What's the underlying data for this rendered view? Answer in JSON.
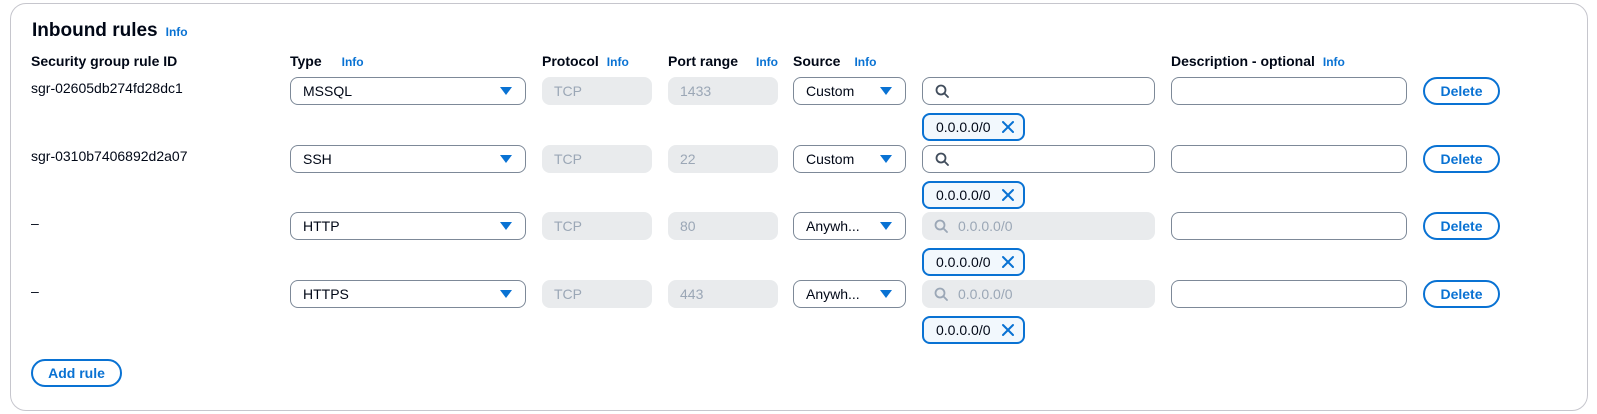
{
  "panel": {
    "title": "Inbound rules",
    "info_label": "Info"
  },
  "columns": {
    "rule_id": "Security group rule ID",
    "type": "Type",
    "protocol": "Protocol",
    "port_range": "Port range",
    "source": "Source",
    "description": "Description - optional",
    "info_label": "Info"
  },
  "rules": [
    {
      "id": "sgr-02605db274fd28dc1",
      "type": "MSSQL",
      "protocol": "TCP",
      "port_range": "1433",
      "source": "Custom",
      "search_value": "",
      "search_placeholder": "",
      "cidr_token": "0.0.0.0/0",
      "description": "",
      "delete_label": "Delete"
    },
    {
      "id": "sgr-0310b7406892d2a07",
      "type": "SSH",
      "protocol": "TCP",
      "port_range": "22",
      "source": "Custom",
      "search_value": "",
      "search_placeholder": "",
      "cidr_token": "0.0.0.0/0",
      "description": "",
      "delete_label": "Delete"
    },
    {
      "id": "–",
      "type": "HTTP",
      "protocol": "TCP",
      "port_range": "80",
      "source": "Anywh...",
      "search_value": "0.0.0.0/0",
      "search_placeholder": "",
      "cidr_token": "0.0.0.0/0",
      "description": "",
      "delete_label": "Delete"
    },
    {
      "id": "–",
      "type": "HTTPS",
      "protocol": "TCP",
      "port_range": "443",
      "source": "Anywh...",
      "search_value": "0.0.0.0/0",
      "search_placeholder": "",
      "cidr_token": "0.0.0.0/0",
      "description": "",
      "delete_label": "Delete"
    }
  ],
  "add_rule_label": "Add rule",
  "icons": {
    "search": "search-icon",
    "dismiss": "close-icon",
    "dropdown": "caret-down-icon"
  },
  "colors": {
    "accent": "#0972d3",
    "text": "#000716",
    "disabled_bg": "#e9ebed",
    "disabled_text": "#9ba7b6",
    "border": "#7d8998"
  }
}
